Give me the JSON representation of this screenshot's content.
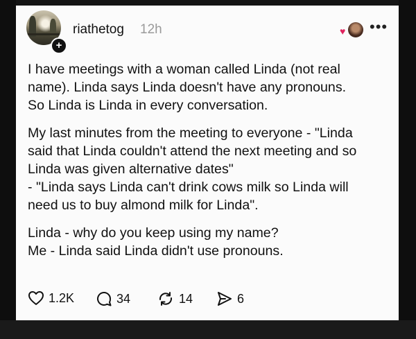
{
  "post": {
    "username": "riathetog",
    "timestamp": "12h",
    "paragraphs": [
      {
        "lines": [
          "I have meetings with a woman called Linda (not real",
          "name). Linda says Linda doesn't have any pronouns.",
          "So Linda is Linda in every conversation."
        ]
      },
      {
        "lines": [
          "My last minutes from the meeting to everyone - \"Linda",
          "said that Linda couldn't attend the next meeting and so",
          "Linda was given alternative dates\"",
          "- \"Linda says Linda can't drink cows milk so Linda will",
          "need us to buy almond milk for Linda\"."
        ]
      },
      {
        "lines": [
          "Linda - why do you keep using my name?",
          "Me - Linda said Linda didn't use pronouns."
        ]
      }
    ],
    "actions": {
      "like_count": "1.2K",
      "reply_count": "34",
      "repost_count": "14",
      "share_count": "6"
    }
  },
  "colors": {
    "heart": "#e0245e",
    "card_bg": "#fbfbfb",
    "text": "#111111",
    "muted": "#9a9a9a"
  },
  "icons": [
    "heart-icon",
    "comment-icon",
    "repost-icon",
    "share-icon",
    "more-icon",
    "follow-plus-icon"
  ]
}
